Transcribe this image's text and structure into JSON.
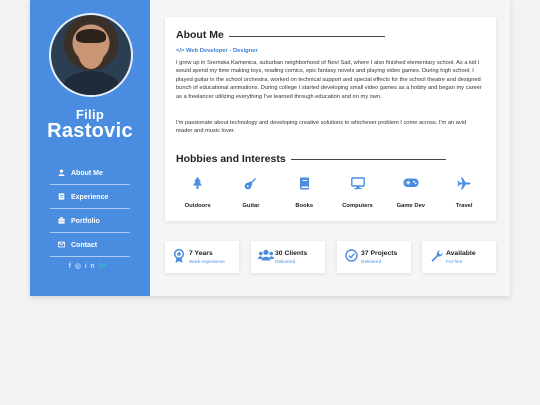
{
  "profile": {
    "first_name": "Filip",
    "last_name": "Rastovic"
  },
  "nav": [
    {
      "label": "About Me",
      "icon": "user-icon"
    },
    {
      "label": "Experience",
      "icon": "id-card-icon"
    },
    {
      "label": "Portfolio",
      "icon": "briefcase-icon"
    },
    {
      "label": "Contact",
      "icon": "envelope-icon"
    }
  ],
  "social": [
    "facebook-icon",
    "instagram-icon",
    "linkedin-icon",
    "twitter-icon"
  ],
  "about": {
    "title": "About Me",
    "role": "Web Developer - Designer",
    "p1": "I grew up in Sremska Kamenica, suburban neighborhood of Novi Sad, where I also finished elementary school. As a kid I would spend my time making toys, reading comics, epic fantasy novels and playing video games. During high school, I played guitar in the school orchestra, worked on technical support and special effects for the school theatre and designed bunch of educational animations. During college I started developing small video games as a hobby and began my career as a freelancer utilizing everything I've learned through education and on my own.",
    "p2": "I'm passionate about technology and developing creative solutions to whichever problem I come across. I'm an avid reader and music lover."
  },
  "hobbies": {
    "title": "Hobbies and Interests",
    "items": [
      {
        "label": "Outdoors",
        "icon": "tree-icon"
      },
      {
        "label": "Guitar",
        "icon": "guitar-icon"
      },
      {
        "label": "Books",
        "icon": "book-icon"
      },
      {
        "label": "Computers",
        "icon": "monitor-icon"
      },
      {
        "label": "Game Dev",
        "icon": "gamepad-icon"
      },
      {
        "label": "Travel",
        "icon": "plane-icon"
      }
    ]
  },
  "stats": [
    {
      "value": "7 Years",
      "sub": "Work experience",
      "icon": "award-icon"
    },
    {
      "value": "30 Clients",
      "sub": "Delivered",
      "icon": "users-icon"
    },
    {
      "value": "37 Projects",
      "sub": "Delivered",
      "icon": "check-circle-icon"
    },
    {
      "value": "Available",
      "sub": "For hire",
      "icon": "wrench-icon"
    }
  ],
  "colors": {
    "accent": "#4a8de0",
    "sidebar": "#4a8de0",
    "background": "#f2f3f5"
  }
}
